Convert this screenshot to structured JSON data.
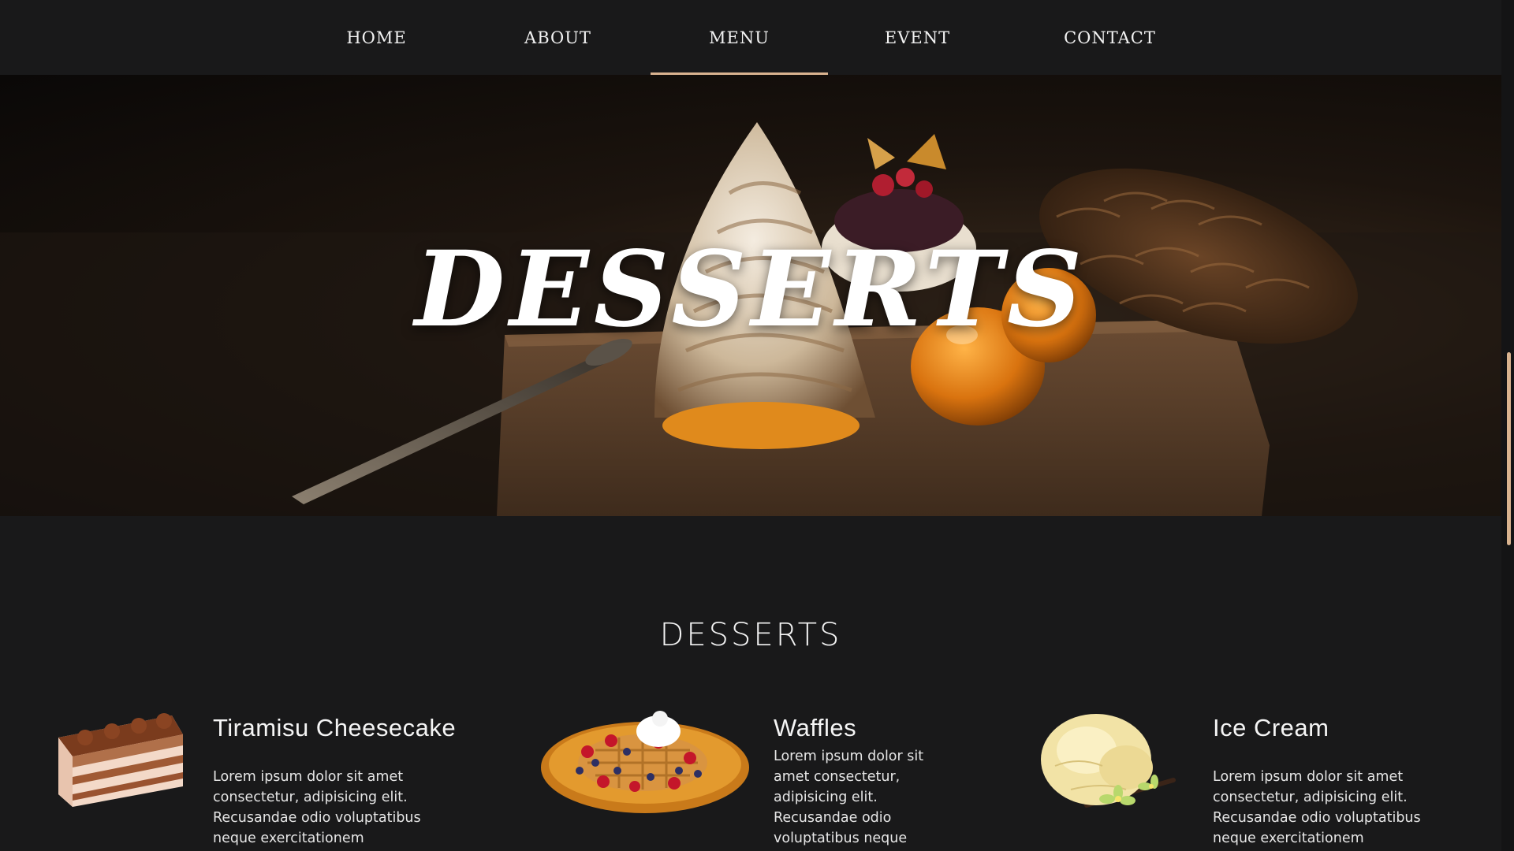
{
  "nav": {
    "items": [
      {
        "label": "HOME"
      },
      {
        "label": "ABOUT"
      },
      {
        "label": "MENU",
        "active": true
      },
      {
        "label": "EVENT"
      },
      {
        "label": "CONTACT"
      }
    ]
  },
  "hero": {
    "title": "DESSERTS"
  },
  "section": {
    "title": "DESSERTS",
    "items": [
      {
        "name": "Tiramisu Cheesecake",
        "image_icon": "tiramisu-cake-image",
        "description": "Lorem ipsum dolor sit amet consectetur, adipisicing elit. Recusandae odio voluptatibus neque exercitationem"
      },
      {
        "name": "Waffles",
        "image_icon": "waffles-image",
        "description": "Lorem ipsum dolor sit amet consectetur, adipisicing elit. Recusandae odio voluptatibus neque"
      },
      {
        "name": "Ice Cream",
        "image_icon": "ice-cream-image",
        "description": "Lorem ipsum dolor sit amet consectetur, adipisicing elit. Recusandae odio voluptatibus neque exercitationem"
      }
    ]
  },
  "colors": {
    "background": "#19191a",
    "accent": "#d9b38f",
    "text": "#f2f2f2"
  }
}
